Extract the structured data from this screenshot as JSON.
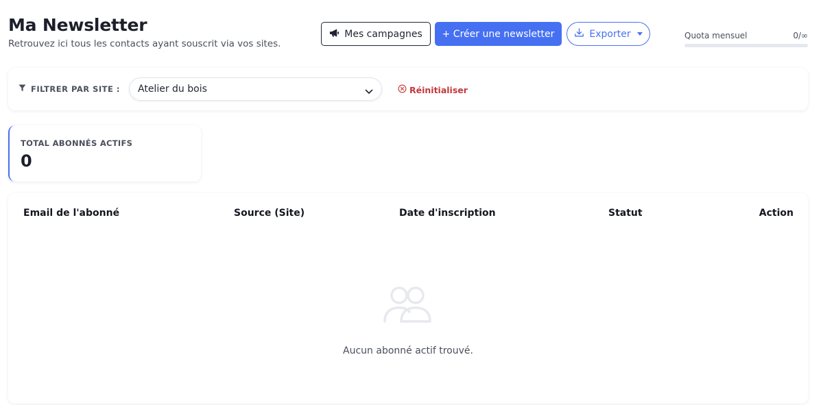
{
  "header": {
    "title": "Ma Newsletter",
    "subtitle": "Retrouvez ici tous les contacts ayant souscrit via vos sites."
  },
  "toolbar": {
    "campaigns_label": "Mes campagnes",
    "create_label": "+ Créer une newsletter",
    "export_label": "Exporter"
  },
  "quota": {
    "label": "Quota mensuel",
    "value": "0/∞",
    "used_fraction": 0
  },
  "filter": {
    "label": "FILTRER PAR SITE :",
    "selected_site": "Atelier du bois",
    "reset_label": "Réinitialiser"
  },
  "stats": {
    "label": "TOTAL ABONNÉS ACTIFS",
    "value": "0"
  },
  "table": {
    "columns": [
      "Email de l'abonné",
      "Source (Site)",
      "Date d'inscription",
      "Statut",
      "Action"
    ],
    "rows": [],
    "empty_message": "Aucun abonné actif trouvé."
  },
  "colors": {
    "accent": "#4670f2",
    "danger": "#c4383d",
    "text": "#1c1f2a"
  },
  "icons": {
    "campaigns": "megaphone-icon",
    "export": "download-icon",
    "filter": "funnel-icon",
    "reset": "circle-x-icon",
    "select": "chevron-down-icon",
    "empty": "users-icon"
  }
}
